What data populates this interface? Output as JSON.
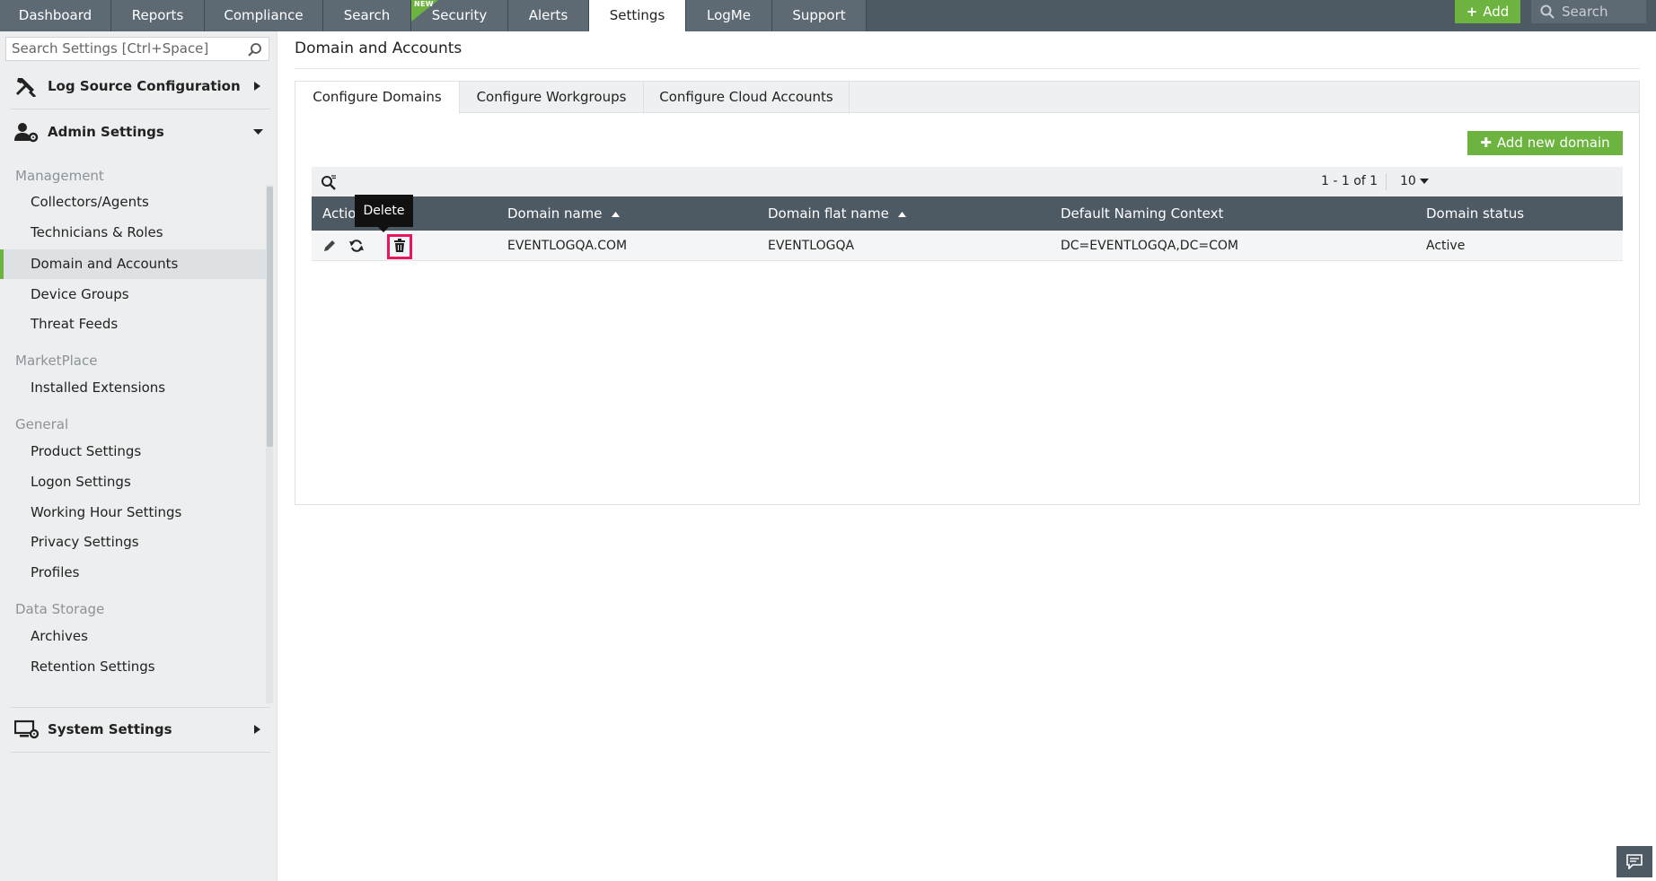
{
  "topnav": {
    "tabs": [
      {
        "label": "Dashboard"
      },
      {
        "label": "Reports"
      },
      {
        "label": "Compliance"
      },
      {
        "label": "Search"
      },
      {
        "label": "Security"
      },
      {
        "label": "Alerts"
      },
      {
        "label": "Settings"
      },
      {
        "label": "LogMe"
      },
      {
        "label": "Support"
      }
    ],
    "active_tab": "Settings",
    "new_badge": "NEW",
    "add_label": "Add",
    "search_placeholder": "Search",
    "colors": {
      "bar": "#4d5963",
      "accent": "#6cb33f"
    }
  },
  "sidebar": {
    "search_placeholder": "Search Settings [Ctrl+Space]",
    "sections": {
      "log_source": {
        "label": "Log Source Configuration",
        "icon": "tools-icon"
      },
      "admin": {
        "label": "Admin Settings",
        "icon": "user-gear-icon"
      },
      "system": {
        "label": "System Settings",
        "icon": "monitor-gear-icon"
      }
    },
    "groups": {
      "management": {
        "title": "Management",
        "items": [
          "Collectors/Agents",
          "Technicians & Roles",
          "Domain and Accounts",
          "Device Groups",
          "Threat Feeds"
        ]
      },
      "marketplace": {
        "title": "MarketPlace",
        "items": [
          "Installed Extensions"
        ]
      },
      "general": {
        "title": "General",
        "items": [
          "Product Settings",
          "Logon Settings",
          "Working Hour Settings",
          "Privacy Settings",
          "Profiles"
        ]
      },
      "data_storage": {
        "title": "Data Storage",
        "items": [
          "Archives",
          "Retention Settings"
        ]
      }
    },
    "active_item": "Domain and Accounts"
  },
  "main": {
    "page_title": "Domain and Accounts",
    "tabs": [
      "Configure Domains",
      "Configure Workgroups",
      "Configure Cloud Accounts"
    ],
    "active_tab": "Configure Domains",
    "add_button": "Add new domain",
    "pager": "1 - 1 of 1",
    "per_page": "10",
    "table": {
      "headers": [
        "Actio",
        "Domain name",
        "Domain flat name",
        "Default Naming Context",
        "Domain status"
      ],
      "rows": [
        {
          "domain_name": "EVENTLOGQA.COM",
          "flat_name": "EVENTLOGQA",
          "naming_context": "DC=EVENTLOGQA,DC=COM",
          "status": "Active",
          "actions": [
            "edit-icon",
            "refresh-icon",
            "delete-icon"
          ]
        }
      ]
    },
    "tooltip": "Delete"
  }
}
